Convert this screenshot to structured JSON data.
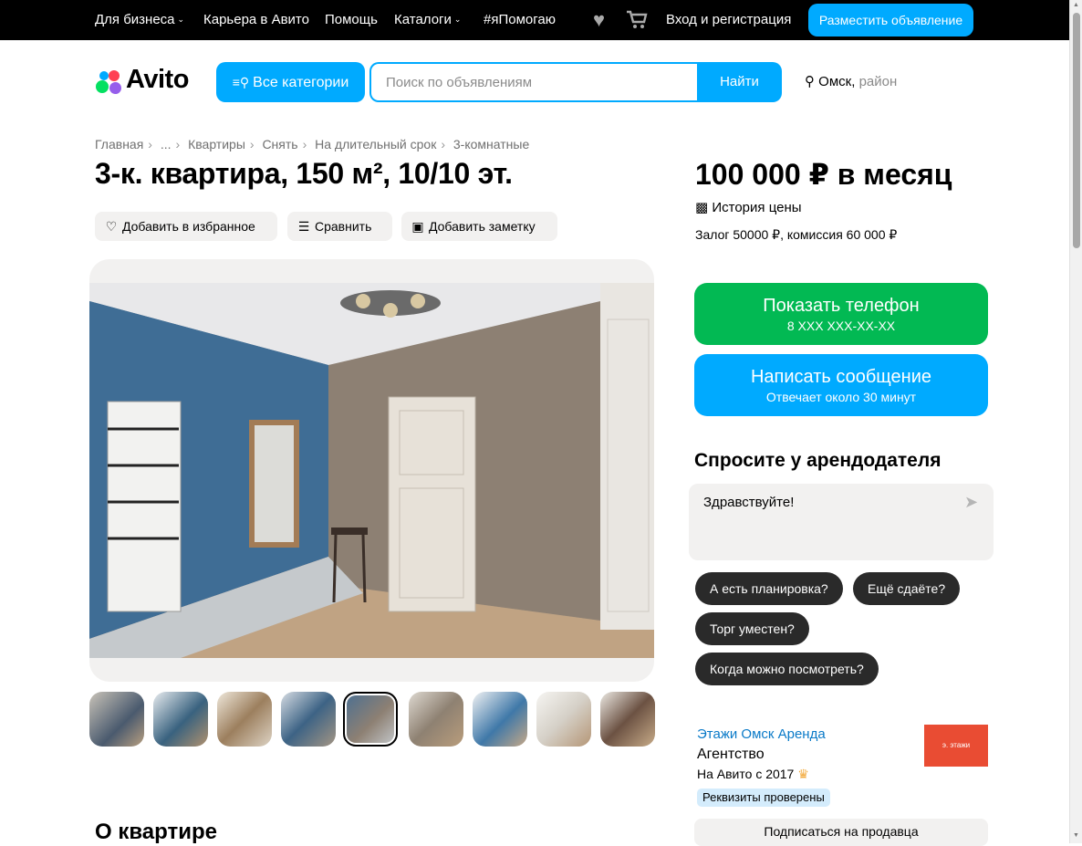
{
  "topbar": {
    "business": "Для бизнеса",
    "career": "Карьера в Авито",
    "help": "Помощь",
    "catalogs": "Каталоги",
    "ipomogayu": "#яПомогаю",
    "login": "Вход и регистрация",
    "post_ad": "Разместить объявление"
  },
  "header": {
    "logo_text": "Avito",
    "all_categories": "Все категории",
    "search_placeholder": "Поиск по объявлениям",
    "search_button": "Найти",
    "city": "Омск,",
    "district": "район"
  },
  "breadcrumbs": [
    "Главная",
    "...",
    "Квартиры",
    "Снять",
    "На длительный срок",
    "3-комнатные"
  ],
  "listing": {
    "title": "3-к. квартира, 150 м², 10/10 эт.",
    "actions": {
      "favorite": "Добавить в избранное",
      "compare": "Сравнить",
      "note": "Добавить заметку"
    },
    "about_heading": "О квартире",
    "gallery_count": 9,
    "selected_photo": 5
  },
  "sidebar": {
    "price": "100 000 ₽ в месяц",
    "price_history": "История цены",
    "deposit": "Залог 50000 ₽, комиссия 60 000 ₽",
    "show_phone": "Показать телефон",
    "phone_mask": "8 XXX XXX-XX-XX",
    "write_message": "Написать сообщение",
    "reply_time": "Отвечает около 30 минут",
    "ask_heading": "Спросите у арендодателя",
    "message_text": "Здравствуйте!",
    "quick_questions": [
      "А есть планировка?",
      "Ещё сдаёте?",
      "Торг уместен?",
      "Когда можно посмотреть?"
    ],
    "seller_name": "Этажи Омск Аренда",
    "seller_type": "Агентство",
    "seller_since": "На Авито с 2017",
    "verified": "Реквизиты проверены",
    "seller_logo_text": "э. этажи",
    "subscribe": "Подписаться на продавца"
  },
  "colors": {
    "accent": "#00aaff",
    "green": "#02b953",
    "dark_chip": "#2a2a2a",
    "pill_bg": "#f2f1f0",
    "seller_link": "#0a7ac8"
  }
}
